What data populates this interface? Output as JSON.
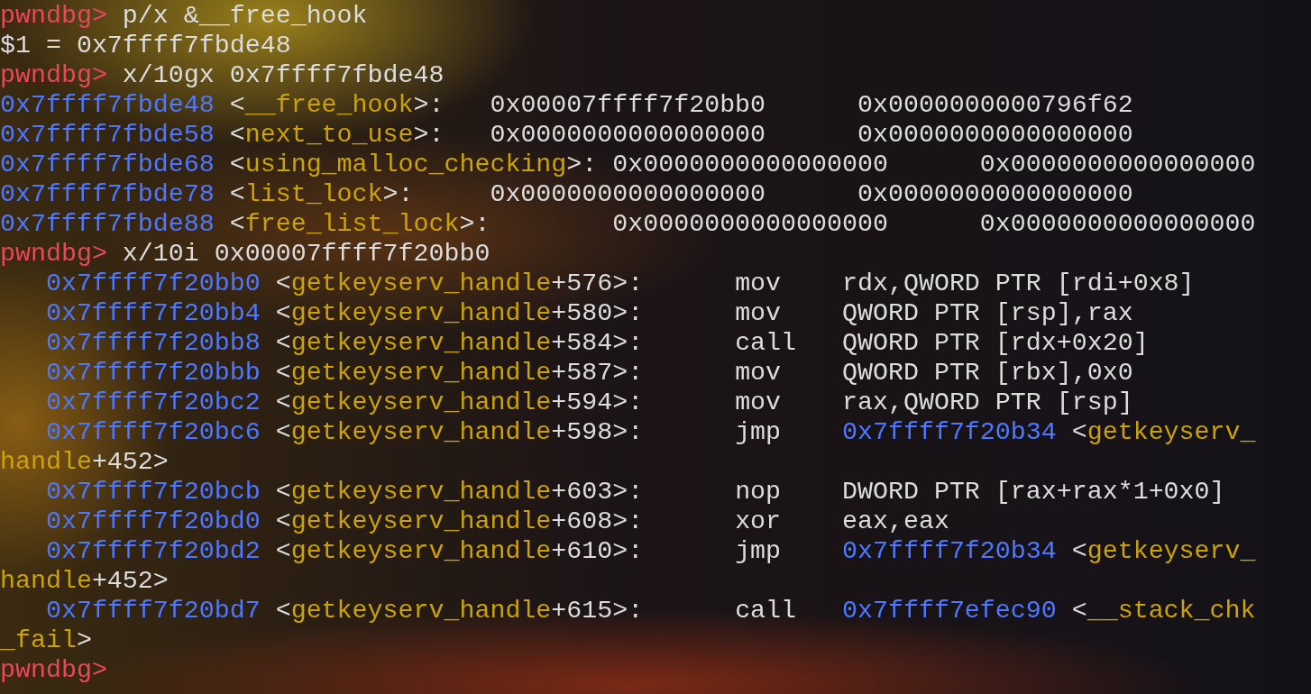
{
  "terminal": {
    "lines": [
      [
        {
          "kind": "prompt",
          "text": "pwndbg> "
        },
        {
          "kind": "text",
          "text": "p/x &__free_hook"
        }
      ],
      [
        {
          "kind": "text",
          "text": "$1 = 0x7ffff7fbde48"
        }
      ],
      [
        {
          "kind": "prompt",
          "text": "pwndbg> "
        },
        {
          "kind": "text",
          "text": "x/10gx 0x7ffff7fbde48"
        }
      ],
      [
        {
          "kind": "addr",
          "text": "0x7ffff7fbde48"
        },
        {
          "kind": "text",
          "text": " <"
        },
        {
          "kind": "sym",
          "text": "__free_hook"
        },
        {
          "kind": "text",
          "text": ">:"
        },
        {
          "kind": "text",
          "text": "   0x00007ffff7f20bb0"
        },
        {
          "kind": "text",
          "text": "      0x0000000000796f62"
        }
      ],
      [
        {
          "kind": "addr",
          "text": "0x7ffff7fbde58"
        },
        {
          "kind": "text",
          "text": " <"
        },
        {
          "kind": "sym",
          "text": "next_to_use"
        },
        {
          "kind": "text",
          "text": ">:"
        },
        {
          "kind": "text",
          "text": "   0x0000000000000000"
        },
        {
          "kind": "text",
          "text": "      0x0000000000000000"
        }
      ],
      [
        {
          "kind": "addr",
          "text": "0x7ffff7fbde68"
        },
        {
          "kind": "text",
          "text": " <"
        },
        {
          "kind": "sym",
          "text": "using_malloc_checking"
        },
        {
          "kind": "text",
          "text": ">:"
        },
        {
          "kind": "text",
          "text": " 0x0000000000000000"
        },
        {
          "kind": "text",
          "text": "      0x0000000000000000"
        }
      ],
      [
        {
          "kind": "addr",
          "text": "0x7ffff7fbde78"
        },
        {
          "kind": "text",
          "text": " <"
        },
        {
          "kind": "sym",
          "text": "list_lock"
        },
        {
          "kind": "text",
          "text": ">:"
        },
        {
          "kind": "text",
          "text": "     0x0000000000000000"
        },
        {
          "kind": "text",
          "text": "      0x0000000000000000"
        }
      ],
      [
        {
          "kind": "addr",
          "text": "0x7ffff7fbde88"
        },
        {
          "kind": "text",
          "text": " <"
        },
        {
          "kind": "sym",
          "text": "free_list_lock"
        },
        {
          "kind": "text",
          "text": ">:"
        },
        {
          "kind": "text",
          "text": "        0x0000000000000000"
        },
        {
          "kind": "text",
          "text": "      0x0000000000000000"
        }
      ],
      [
        {
          "kind": "prompt",
          "text": "pwndbg> "
        },
        {
          "kind": "text",
          "text": "x/10i 0x00007ffff7f20bb0"
        }
      ],
      [
        {
          "kind": "addr",
          "text": "   0x7ffff7f20bb0"
        },
        {
          "kind": "text",
          "text": " <"
        },
        {
          "kind": "sym",
          "text": "getkeyserv_handle"
        },
        {
          "kind": "text",
          "text": "+576>:"
        },
        {
          "kind": "text",
          "text": "      mov"
        },
        {
          "kind": "text",
          "text": "    rdx,QWORD PTR [rdi+0x8]"
        }
      ],
      [
        {
          "kind": "addr",
          "text": "   0x7ffff7f20bb4"
        },
        {
          "kind": "text",
          "text": " <"
        },
        {
          "kind": "sym",
          "text": "getkeyserv_handle"
        },
        {
          "kind": "text",
          "text": "+580>:"
        },
        {
          "kind": "text",
          "text": "      mov"
        },
        {
          "kind": "text",
          "text": "    QWORD PTR [rsp],rax"
        }
      ],
      [
        {
          "kind": "addr",
          "text": "   0x7ffff7f20bb8"
        },
        {
          "kind": "text",
          "text": " <"
        },
        {
          "kind": "sym",
          "text": "getkeyserv_handle"
        },
        {
          "kind": "text",
          "text": "+584>:"
        },
        {
          "kind": "text",
          "text": "      call"
        },
        {
          "kind": "text",
          "text": "   QWORD PTR [rdx+0x20]"
        }
      ],
      [
        {
          "kind": "addr",
          "text": "   0x7ffff7f20bbb"
        },
        {
          "kind": "text",
          "text": " <"
        },
        {
          "kind": "sym",
          "text": "getkeyserv_handle"
        },
        {
          "kind": "text",
          "text": "+587>:"
        },
        {
          "kind": "text",
          "text": "      mov"
        },
        {
          "kind": "text",
          "text": "    QWORD PTR [rbx],0x0"
        }
      ],
      [
        {
          "kind": "addr",
          "text": "   0x7ffff7f20bc2"
        },
        {
          "kind": "text",
          "text": " <"
        },
        {
          "kind": "sym",
          "text": "getkeyserv_handle"
        },
        {
          "kind": "text",
          "text": "+594>:"
        },
        {
          "kind": "text",
          "text": "      mov"
        },
        {
          "kind": "text",
          "text": "    rax,QWORD PTR [rsp]"
        }
      ],
      [
        {
          "kind": "addr",
          "text": "   0x7ffff7f20bc6"
        },
        {
          "kind": "text",
          "text": " <"
        },
        {
          "kind": "sym",
          "text": "getkeyserv_handle"
        },
        {
          "kind": "text",
          "text": "+598>:"
        },
        {
          "kind": "text",
          "text": "      jmp"
        },
        {
          "kind": "addr",
          "text": "    0x7ffff7f20b34"
        },
        {
          "kind": "text",
          "text": " <"
        },
        {
          "kind": "sym",
          "text": "getkeyserv_"
        }
      ],
      [
        {
          "kind": "sym",
          "text": "handle"
        },
        {
          "kind": "text",
          "text": "+452>"
        }
      ],
      [
        {
          "kind": "addr",
          "text": "   0x7ffff7f20bcb"
        },
        {
          "kind": "text",
          "text": " <"
        },
        {
          "kind": "sym",
          "text": "getkeyserv_handle"
        },
        {
          "kind": "text",
          "text": "+603>:"
        },
        {
          "kind": "text",
          "text": "      nop"
        },
        {
          "kind": "text",
          "text": "    DWORD PTR [rax+rax*1+0x0]"
        }
      ],
      [
        {
          "kind": "addr",
          "text": "   0x7ffff7f20bd0"
        },
        {
          "kind": "text",
          "text": " <"
        },
        {
          "kind": "sym",
          "text": "getkeyserv_handle"
        },
        {
          "kind": "text",
          "text": "+608>:"
        },
        {
          "kind": "text",
          "text": "      xor"
        },
        {
          "kind": "text",
          "text": "    eax,eax"
        }
      ],
      [
        {
          "kind": "addr",
          "text": "   0x7ffff7f20bd2"
        },
        {
          "kind": "text",
          "text": " <"
        },
        {
          "kind": "sym",
          "text": "getkeyserv_handle"
        },
        {
          "kind": "text",
          "text": "+610>:"
        },
        {
          "kind": "text",
          "text": "      jmp"
        },
        {
          "kind": "addr",
          "text": "    0x7ffff7f20b34"
        },
        {
          "kind": "text",
          "text": " <"
        },
        {
          "kind": "sym",
          "text": "getkeyserv_"
        }
      ],
      [
        {
          "kind": "sym",
          "text": "handle"
        },
        {
          "kind": "text",
          "text": "+452>"
        }
      ],
      [
        {
          "kind": "addr",
          "text": "   0x7ffff7f20bd7"
        },
        {
          "kind": "text",
          "text": " <"
        },
        {
          "kind": "sym",
          "text": "getkeyserv_handle"
        },
        {
          "kind": "text",
          "text": "+615>:"
        },
        {
          "kind": "text",
          "text": "      call"
        },
        {
          "kind": "addr",
          "text": "   0x7ffff7efec90"
        },
        {
          "kind": "text",
          "text": " <"
        },
        {
          "kind": "sym",
          "text": "__stack_chk"
        }
      ],
      [
        {
          "kind": "sym",
          "text": "_fail"
        },
        {
          "kind": "text",
          "text": ">"
        }
      ],
      [
        {
          "kind": "prompt",
          "text": "pwndbg>"
        }
      ]
    ]
  }
}
